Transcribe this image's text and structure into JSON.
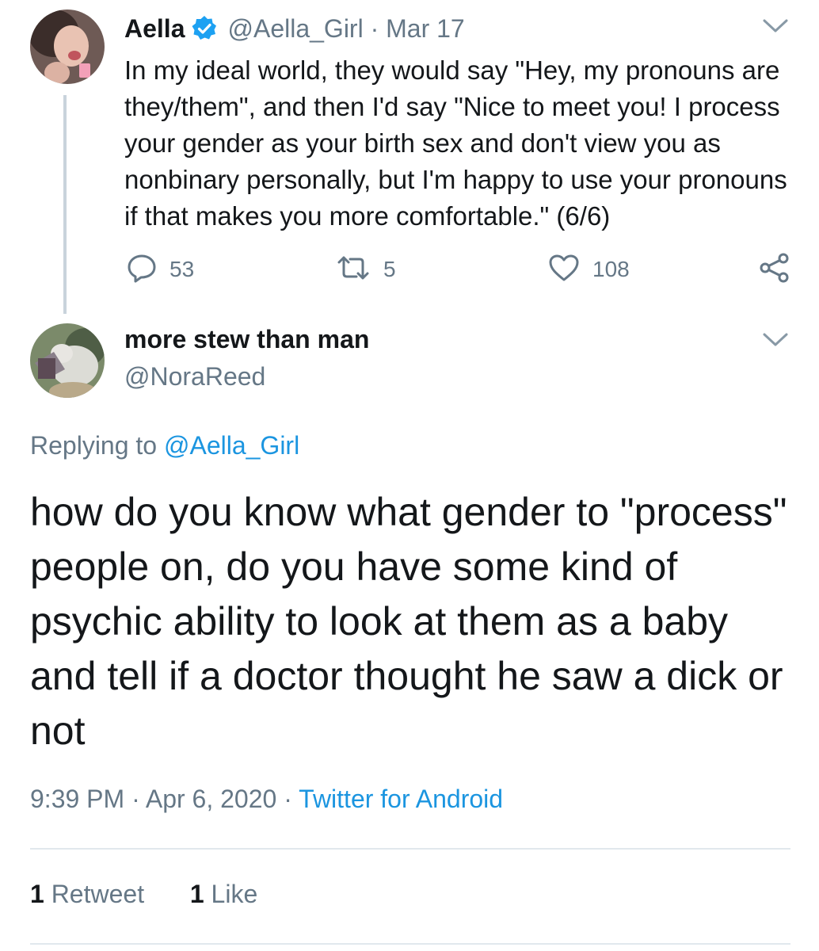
{
  "parent_tweet": {
    "display_name": "Aella",
    "verified": true,
    "handle": "@Aella_Girl",
    "separator": "·",
    "date": "Mar 17",
    "text": "In my ideal world, they would say \"Hey, my pronouns are they/them\", and then I'd say \"Nice to meet you! I process your gender as your birth sex and don't view you as nonbinary personally, but I'm happy to use your pronouns if that makes you more comfortable.\" (6/6)",
    "actions": {
      "reply_count": "53",
      "retweet_count": "5",
      "like_count": "108"
    },
    "icons": [
      "avatar",
      "verified-badge-icon",
      "chevron-down-icon",
      "reply-icon",
      "retweet-icon",
      "like-icon",
      "share-icon"
    ]
  },
  "reply_tweet": {
    "display_name": "more stew than man",
    "handle": "@NoraReed",
    "replying_prefix": "Replying to",
    "replying_to": "@Aella_Girl",
    "text": "how do you know what gender to \"process\" people on, do you have some kind of psychic ability to look at them as a baby and tell if a doctor thought he saw a dick or not",
    "time": "9:39 PM",
    "sep1": "·",
    "date": "Apr 6, 2020",
    "sep2": "·",
    "source": "Twitter for Android",
    "retweets_count": "1",
    "retweets_label": "Retweet",
    "likes_count": "1",
    "likes_label": "Like"
  },
  "colors": {
    "text": "#14171a",
    "secondary": "#657786",
    "link": "#1b95e0",
    "verified": "#1da1f2",
    "divider": "#e1e8ed",
    "thread_line": "#c9d3dc"
  }
}
